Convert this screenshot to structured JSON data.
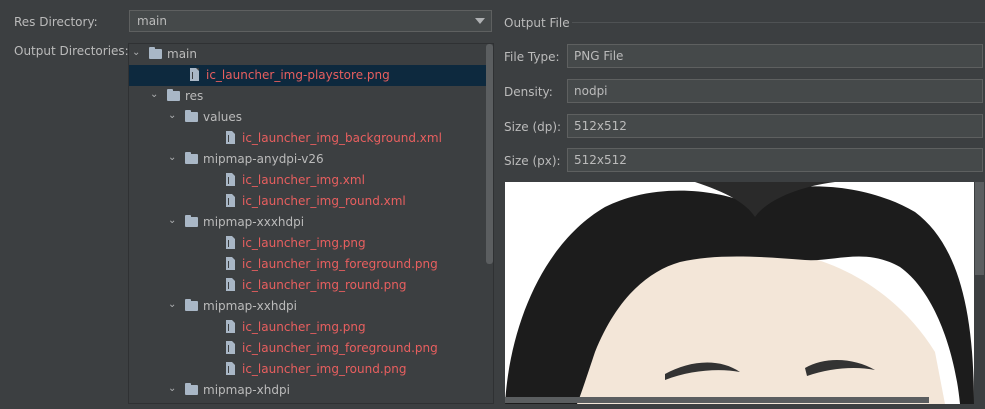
{
  "labels": {
    "res_directory": "Res Directory:",
    "output_directories": "Output Directories:",
    "output_file": "Output File",
    "file_type": "File Type:",
    "density": "Density:",
    "size_dp": "Size (dp):",
    "size_px": "Size (px):"
  },
  "res_directory": {
    "value": "main"
  },
  "tree": [
    {
      "label": "main",
      "kind": "folder",
      "depth": 0,
      "expanded": true
    },
    {
      "label": "ic_launcher_img-playstore.png",
      "kind": "file",
      "depth": 1,
      "selected": true
    },
    {
      "label": "res",
      "kind": "folder",
      "depth": 1,
      "expanded": true
    },
    {
      "label": "values",
      "kind": "folder",
      "depth": 2,
      "expanded": true
    },
    {
      "label": "ic_launcher_img_background.xml",
      "kind": "file",
      "depth": 3
    },
    {
      "label": "mipmap-anydpi-v26",
      "kind": "folder",
      "depth": 2,
      "expanded": true
    },
    {
      "label": "ic_launcher_img.xml",
      "kind": "file",
      "depth": 3
    },
    {
      "label": "ic_launcher_img_round.xml",
      "kind": "file",
      "depth": 3
    },
    {
      "label": "mipmap-xxxhdpi",
      "kind": "folder",
      "depth": 2,
      "expanded": true
    },
    {
      "label": "ic_launcher_img.png",
      "kind": "file",
      "depth": 3
    },
    {
      "label": "ic_launcher_img_foreground.png",
      "kind": "file",
      "depth": 3
    },
    {
      "label": "ic_launcher_img_round.png",
      "kind": "file",
      "depth": 3
    },
    {
      "label": "mipmap-xxhdpi",
      "kind": "folder",
      "depth": 2,
      "expanded": true
    },
    {
      "label": "ic_launcher_img.png",
      "kind": "file",
      "depth": 3
    },
    {
      "label": "ic_launcher_img_foreground.png",
      "kind": "file",
      "depth": 3
    },
    {
      "label": "ic_launcher_img_round.png",
      "kind": "file",
      "depth": 3
    },
    {
      "label": "mipmap-xhdpi",
      "kind": "folder",
      "depth": 2,
      "expanded": true
    }
  ],
  "output_file": {
    "file_type": "PNG File",
    "density": "nodpi",
    "size_dp": "512x512",
    "size_px": "512x512"
  },
  "colors": {
    "background": "#3c3f41",
    "file_text": "#e85f5f",
    "selection": "#0d293e",
    "preview_hair": "#1c1c1c",
    "preview_skin": "#f3e6d8"
  },
  "icons": {
    "expand": "chevron-down-icon",
    "folder": "folder-icon",
    "file": "file-icon",
    "dropdown": "dropdown-arrow-icon"
  }
}
